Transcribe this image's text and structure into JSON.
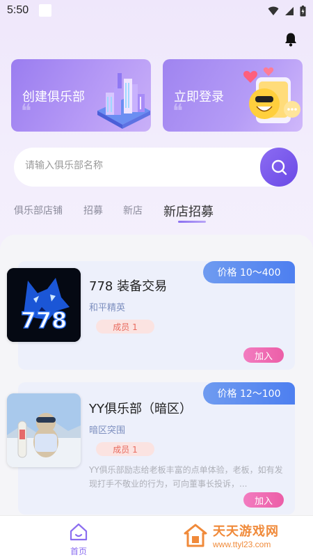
{
  "status_bar": {
    "time": "5:50"
  },
  "banners": [
    {
      "label": "创建俱乐部"
    },
    {
      "label": "立即登录"
    }
  ],
  "search": {
    "placeholder": "请输入俱乐部名称"
  },
  "tabs": [
    {
      "label": "俱乐部店铺",
      "active": false
    },
    {
      "label": "招募",
      "active": false
    },
    {
      "label": "新店",
      "active": false
    },
    {
      "label": "新店招募",
      "active": true
    }
  ],
  "cards": [
    {
      "price": "价格 10～400",
      "title": "778 装备交易",
      "subtitle": "和平精英",
      "members": "成员 1",
      "description": "",
      "join_label": "加入",
      "thumb_text": "778"
    },
    {
      "price": "价格 12～100",
      "title": "YY俱乐部（暗区）",
      "subtitle": "暗区突围",
      "members": "成员 1",
      "description": "YY俱乐部励志给老板丰富的点单体验，老板，如有发现打手不敬业的行为，可向董事长投诉，...",
      "join_label": "加入"
    }
  ],
  "bottom_nav": {
    "home_label": "首页"
  },
  "watermark": {
    "title": "天天游戏网",
    "url": "www.ttyl23.com"
  },
  "colors": {
    "accent": "#8b6df0",
    "price_tag": "#4d7ff0",
    "join": "#ec5ea7",
    "member": "#e86a5e"
  }
}
